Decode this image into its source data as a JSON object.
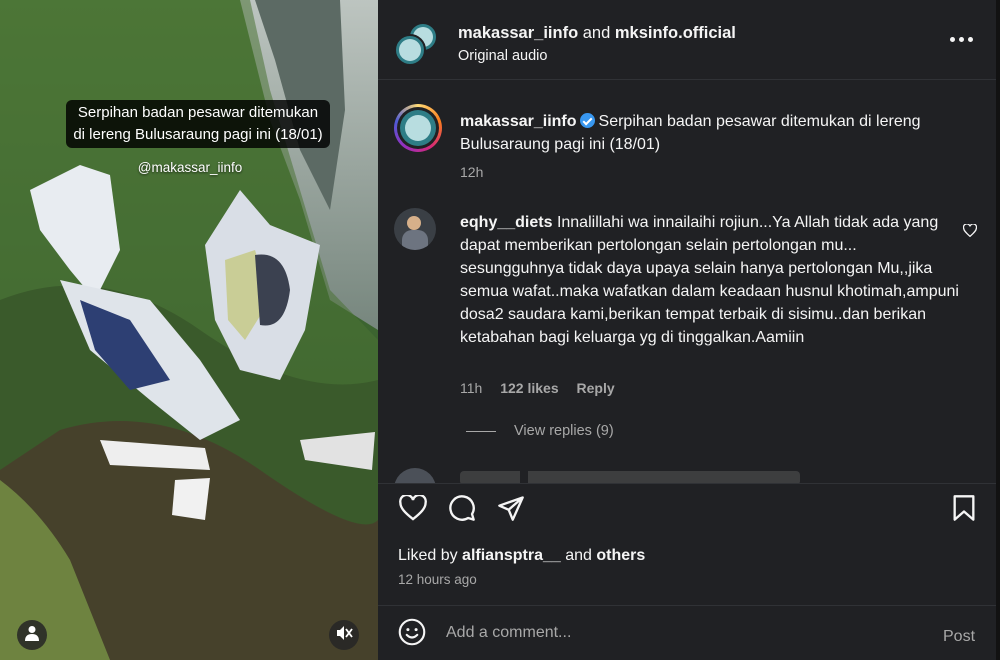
{
  "media": {
    "overlay_caption": "Serpihan badan pesawar ditemukan di lereng Bulusaraung pagi ini (18/01)",
    "overlay_handle": "@makassar_iinfo",
    "icons": {
      "user": "user-icon",
      "mute": "muted-speaker-icon"
    }
  },
  "header": {
    "user1": "makassar_iinfo",
    "joiner": "and",
    "user2": "mksinfo.official",
    "audio": "Original audio",
    "more_icon": "more-options-icon"
  },
  "caption": {
    "username": "makassar_iinfo",
    "text": "Serpihan badan pesawar ditemukan di lereng Bulusaraung pagi ini (18/01)",
    "time": "12h"
  },
  "comment": {
    "username": "eqhy__diets",
    "text": "Innalillahi wa innailaihi rojiun...Ya Allah tidak ada yang dapat memberikan pertolongan selain pertolongan mu... sesungguhnya tidak daya upaya selain hanya pertolongan Mu,,jika semua wafat..maka wafatkan dalam keadaan husnul khotimah,ampuni dosa2 saudara kami,berikan tempat terbaik di sisimu..dan berikan ketabahan bagi keluarga yg di tinggalkan.Aamiin",
    "time": "11h",
    "likes": "122 likes",
    "reply": "Reply",
    "view_replies": "View replies (9)"
  },
  "actions": {
    "icons": [
      "heart-icon",
      "comment-icon",
      "share-icon",
      "bookmark-icon"
    ],
    "liked_prefix": "Liked by",
    "liked_user": "alfiansptra__",
    "liked_mid": "and",
    "liked_others": "others",
    "time_ago": "12 hours ago"
  },
  "add_comment": {
    "placeholder": "Add a comment...",
    "post": "Post"
  },
  "colors": {
    "panel_bg": "#202124",
    "text": "#f5f5f5",
    "muted": "#a8a8a8",
    "verified": "#3897f0"
  }
}
